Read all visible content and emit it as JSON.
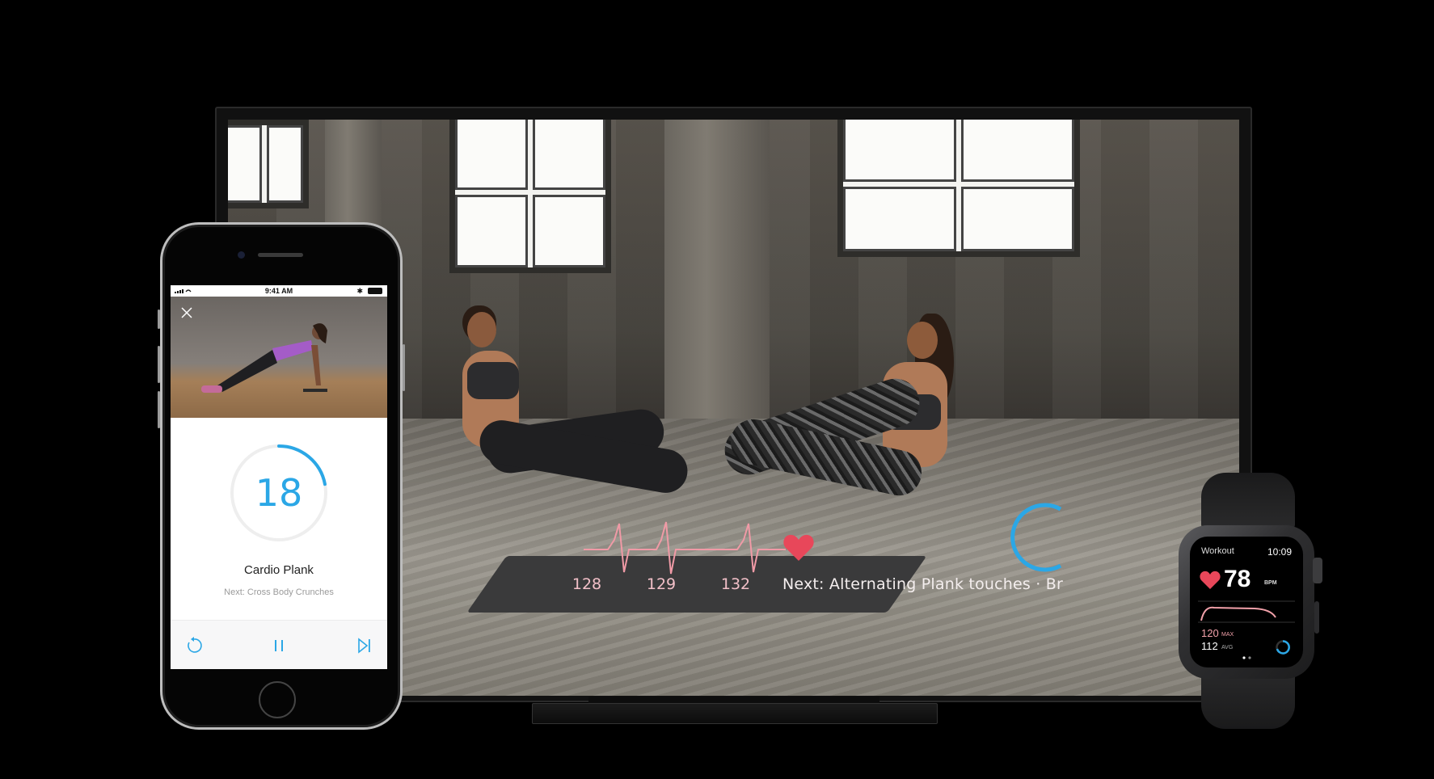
{
  "colors": {
    "accent_blue": "#2ba7e6",
    "heart_red": "#e8475a",
    "hr_text_pink": "#f2c0c8",
    "watch_max_pink": "#f2a1aa"
  },
  "tv": {
    "heart_rate_values": [
      "128",
      "129",
      "132"
    ],
    "next_ticker": "Next: Alternating Plank touches  ·  Br",
    "icons": [
      "heartbeat-line-icon",
      "heart-icon",
      "progress-ring-icon"
    ]
  },
  "phone": {
    "status": {
      "time": "9:41 AM",
      "bluetooth": "✱"
    },
    "timer": {
      "value": "18",
      "progress_fraction": 0.22
    },
    "exercise": {
      "title": "Cardio Plank",
      "next": "Next: Cross Body Crunches"
    },
    "controls": [
      "restart-icon",
      "pause-icon",
      "skip-forward-icon"
    ]
  },
  "watch": {
    "title": "Workout",
    "time": "10:09",
    "bpm": "78",
    "bpm_unit": "BPM",
    "max": "120",
    "max_unit": "MAX",
    "avg": "112",
    "avg_unit": "AVG"
  }
}
